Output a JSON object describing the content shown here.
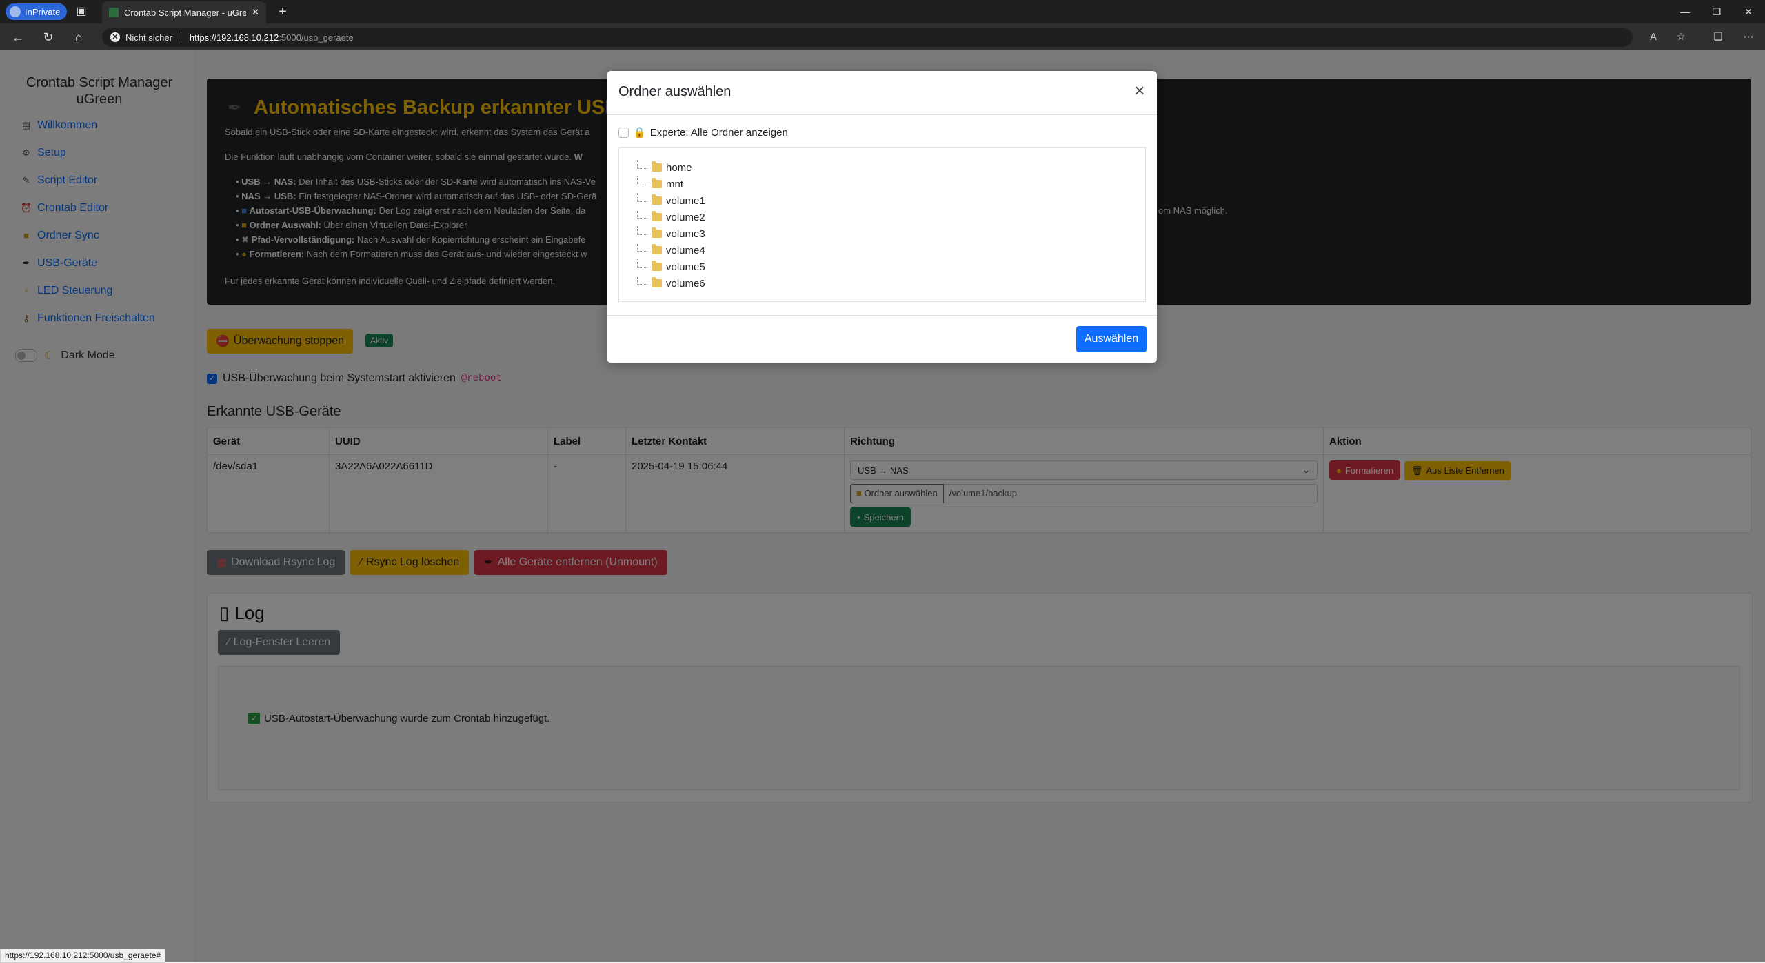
{
  "browser": {
    "inprivate_label": "InPrivate",
    "tab_title": "Crontab Script Manager - uGreen",
    "security_label": "Nicht sicher",
    "url_host": "https://192.168.10.212",
    "url_path": ":5000/usb_geraete",
    "status_url": "https://192.168.10.212:5000/usb_geraete#"
  },
  "sidebar": {
    "title_line1": "Crontab Script Manager",
    "title_line2": "uGreen",
    "items": [
      {
        "label": "Willkommen",
        "icon": "document-icon"
      },
      {
        "label": "Setup",
        "icon": "gear-icon"
      },
      {
        "label": "Script Editor",
        "icon": "script-icon"
      },
      {
        "label": "Crontab Editor",
        "icon": "alarm-clock-icon"
      },
      {
        "label": "Ordner Sync",
        "icon": "folder-icon"
      },
      {
        "label": "USB-Geräte",
        "icon": "usb-icon"
      },
      {
        "label": "LED Steuerung",
        "icon": "bulb-icon"
      },
      {
        "label": "Funktionen Freischalten",
        "icon": "key-icon"
      }
    ],
    "dark_mode_label": "Dark Mode"
  },
  "hero": {
    "title": "Automatisches Backup erkannter USB- u",
    "p1": "Sobald ein USB-Stick oder eine SD-Karte eingesteckt wird, erkennt das System das Gerät a",
    "p2_a": "Die Funktion läuft unabhängig vom Container weiter, sobald sie einmal gestartet wurde. ",
    "p2_b": "W",
    "items": [
      {
        "bold": "USB → NAS:",
        "text": " Der Inhalt des USB-Sticks oder der SD-Karte wird automatisch ins NAS-Ve"
      },
      {
        "bold": "NAS → USB:",
        "text": " Ein festgelegter NAS-Ordner wird automatisch auf das USB- oder SD-Gerä"
      },
      {
        "bold": "Autostart-USB-Überwachung:",
        "text": " Der Log zeigt erst nach dem Neuladen der Seite, da"
      },
      {
        "bold": "Ordner Auswahl:",
        "text": " Über einen Virtuellen Datei-Explorer"
      },
      {
        "bold": "Pfad-Vervollständigung:",
        "text": " Nach Auswahl der Kopierrichtung erscheint ein Eingabefe"
      },
      {
        "bold": "Formatieren:",
        "text": " Nach dem Formatieren muss das Gerät aus- und wieder eingesteckt w"
      }
    ],
    "right_fragment": "om NAS möglich.",
    "footer": "Für jedes erkannte Gerät können individuelle Quell- und Zielpfade definiert werden."
  },
  "monitor": {
    "stop_label": "Überwachung stoppen",
    "status": "Aktiv",
    "autostart_label": "USB-Überwachung beim Systemstart aktivieren ",
    "autostart_code": "@reboot"
  },
  "usb": {
    "heading": "Erkannte USB-Geräte",
    "columns": [
      "Gerät",
      "UUID",
      "Label",
      "Letzter Kontakt",
      "Richtung",
      "Aktion"
    ],
    "rows": [
      {
        "device": "/dev/sda1",
        "uuid": "3A22A6A022A6611D",
        "label": "-",
        "last_contact": "2025-04-19 15:06:44",
        "direction": "USB → NAS",
        "folder_button": "Ordner auswählen",
        "path": "/volume1/backup",
        "save": "Speichern",
        "format": "Formatieren",
        "remove": "Aus Liste Entfernen"
      }
    ]
  },
  "actions": {
    "download": "Download Rsync Log",
    "clear_rsync": "Rsync Log löschen",
    "unmount": "Alle Geräte entfernen (Unmount)"
  },
  "log": {
    "title": "Log",
    "clear": "Log-Fenster Leeren",
    "line": "USB-Autostart-Überwachung wurde zum Crontab hinzugefügt."
  },
  "modal": {
    "title": "Ordner auswählen",
    "expert_label": "Experte: Alle Ordner anzeigen",
    "folders": [
      "home",
      "mnt",
      "volume1",
      "volume2",
      "volume3",
      "volume4",
      "volume5",
      "volume6"
    ],
    "select_label": "Auswählen"
  }
}
